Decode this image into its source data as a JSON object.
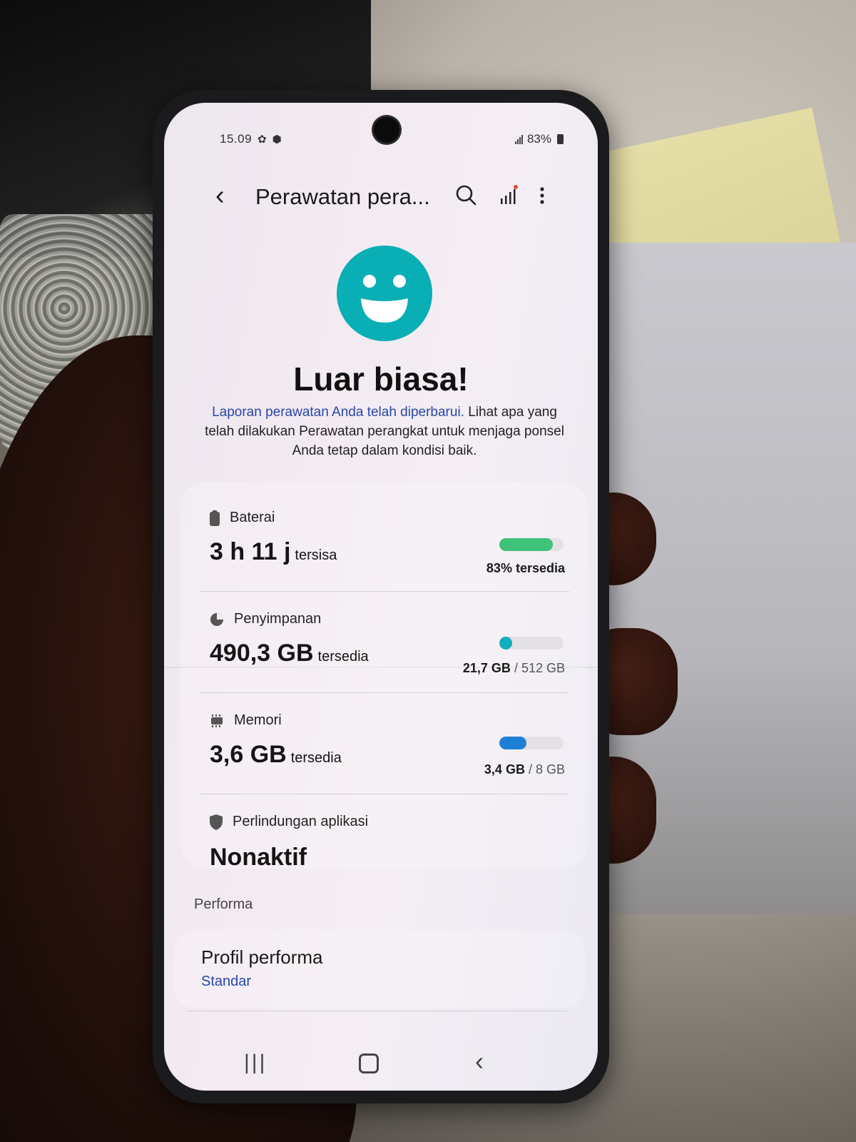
{
  "status_bar": {
    "time": "15.09",
    "battery_percent": "83%"
  },
  "app_bar": {
    "title": "Perawatan pera..."
  },
  "hero": {
    "headline": "Luar biasa!",
    "description_link": "Laporan perawatan Anda telah diperbarui.",
    "description_rest": " Lihat apa yang telah dilakukan Perawatan perangkat untuk menjaga ponsel Anda tetap dalam kondisi baik.",
    "accent_color": "#0aaeb5"
  },
  "battery": {
    "label": "Baterai",
    "value": "3 h 11 j",
    "unit": "tersisa",
    "status": "83% tersedia",
    "level": 0.83,
    "bar_color": "#3fc27a"
  },
  "storage": {
    "label": "Penyimpanan",
    "value": "490,3 GB",
    "unit": "tersedia",
    "used": "21,7 GB",
    "total": "/ 512 GB",
    "level": 0.042,
    "bar_color": "#11aebd"
  },
  "memory": {
    "label": "Memori",
    "value": "3,6 GB",
    "unit": "tersedia",
    "used": "3,4 GB",
    "total": "/ 8 GB",
    "level": 0.425,
    "bar_color": "#1f7fd6"
  },
  "app_protection": {
    "label": "Perlindungan aplikasi",
    "value": "Nonaktif"
  },
  "performance": {
    "section_label": "Performa",
    "profile_title": "Profil performa",
    "profile_value": "Standar"
  }
}
